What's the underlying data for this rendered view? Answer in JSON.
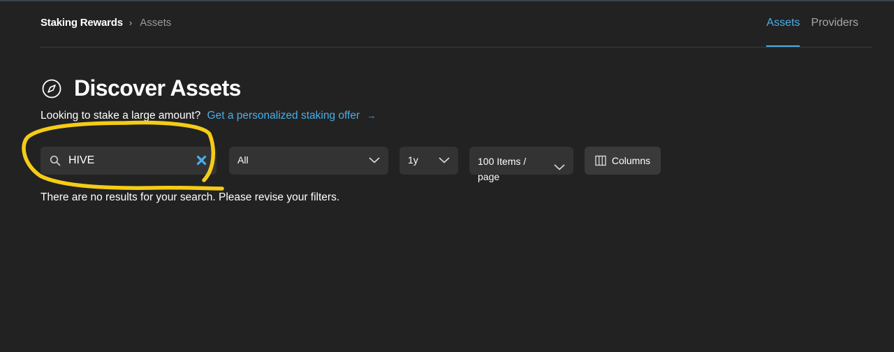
{
  "header": {
    "breadcrumb_root": "Staking Rewards",
    "breadcrumb_separator": "›",
    "breadcrumb_current": "Assets",
    "nav_tabs": [
      {
        "label": "Assets",
        "active": true
      },
      {
        "label": "Providers",
        "active": false
      }
    ]
  },
  "page": {
    "title": "Discover Assets",
    "title_icon": "compass-icon",
    "subtitle_text": "Looking to stake a large amount?",
    "offer_link": "Get a personalized staking offer",
    "offer_arrow": "→"
  },
  "filters": {
    "search_value": "HIVE",
    "category_value": "All",
    "period_value": "1y",
    "items_per_page": "100 Items / page",
    "columns_label": "Columns"
  },
  "results": {
    "message": "There are no results for your search. Please revise your filters."
  },
  "colors": {
    "background": "#222222",
    "accent": "#4aaee8",
    "control_bg": "#333333",
    "annotation": "#f5cc16"
  }
}
